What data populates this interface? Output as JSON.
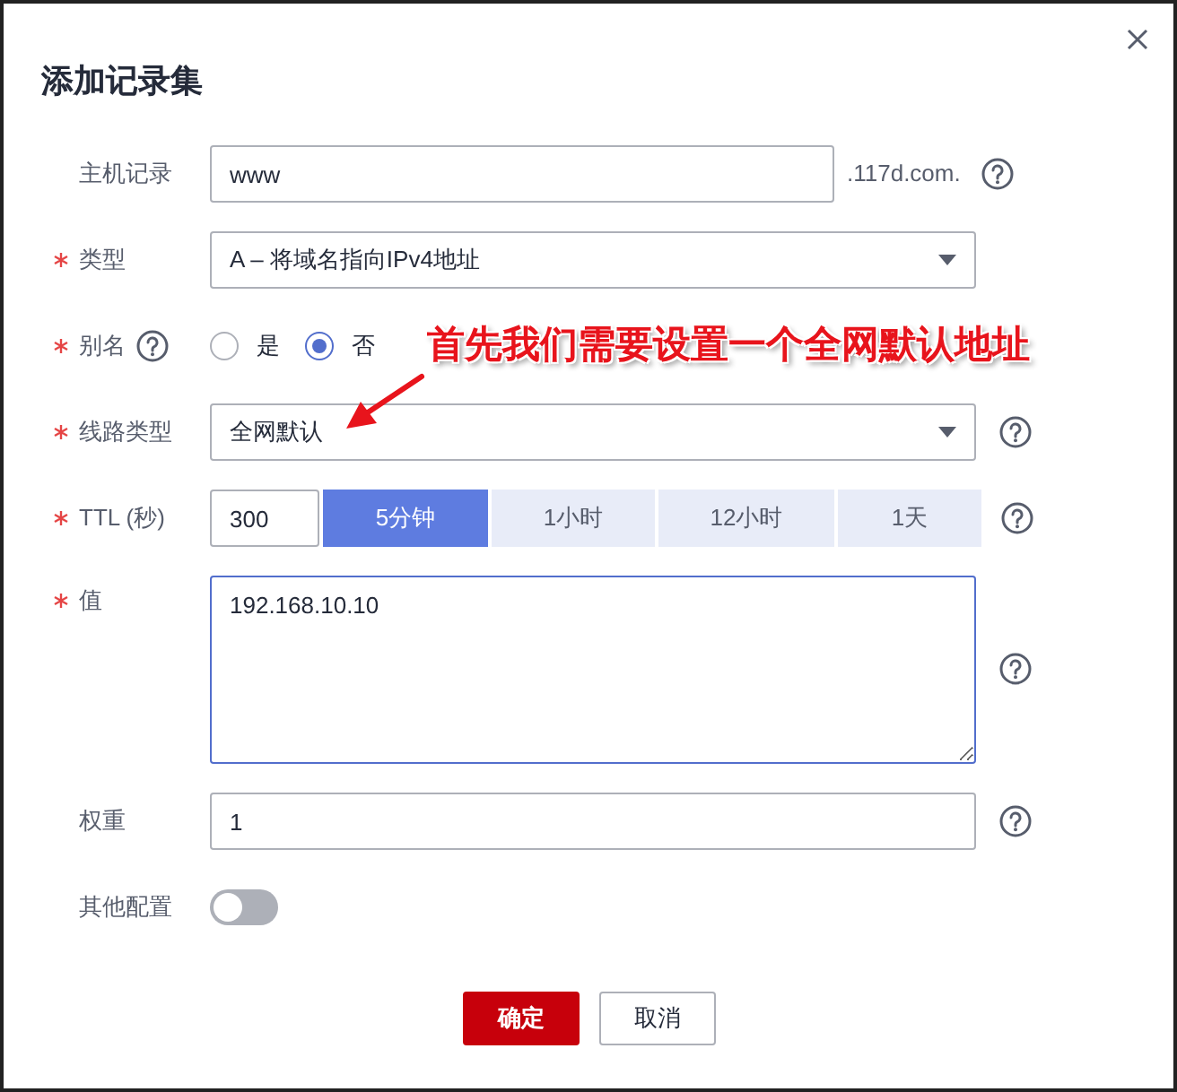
{
  "dialog": {
    "title": "添加记录集"
  },
  "fields": [
    {
      "kind": "text",
      "label": "主机记录",
      "required": false,
      "value": "www",
      "suffix": ".117d.com.",
      "help": true
    },
    {
      "kind": "select",
      "label": "类型",
      "required": true,
      "value": "A – 将域名指向IPv4地址",
      "help": false
    },
    {
      "kind": "radio",
      "label": "别名",
      "required": true,
      "help": true,
      "options": [
        {
          "label": "是",
          "selected": false
        },
        {
          "label": "否",
          "selected": true
        }
      ]
    },
    {
      "kind": "select",
      "label": "线路类型",
      "required": true,
      "value": "全网默认",
      "help": true
    },
    {
      "kind": "ttl",
      "label": "TTL (秒)",
      "required": true,
      "value": "300",
      "help": true,
      "options": [
        {
          "label": "5分钟",
          "selected": true
        },
        {
          "label": "1小时",
          "selected": false
        },
        {
          "label": "12小时",
          "selected": false
        },
        {
          "label": "1天",
          "selected": false
        }
      ]
    },
    {
      "kind": "textarea",
      "label": "值",
      "required": true,
      "value": "192.168.10.10",
      "focused": true,
      "help": true
    },
    {
      "kind": "text",
      "label": "权重",
      "required": false,
      "value": "1",
      "help": true
    },
    {
      "kind": "switch",
      "label": "其他配置",
      "required": false,
      "on": false
    }
  ],
  "buttons": [
    {
      "label": "确定",
      "kind": "primary"
    },
    {
      "label": "取消",
      "kind": "default"
    }
  ],
  "annotation": {
    "text": "首先我们需要设置一个全网默认地址"
  }
}
